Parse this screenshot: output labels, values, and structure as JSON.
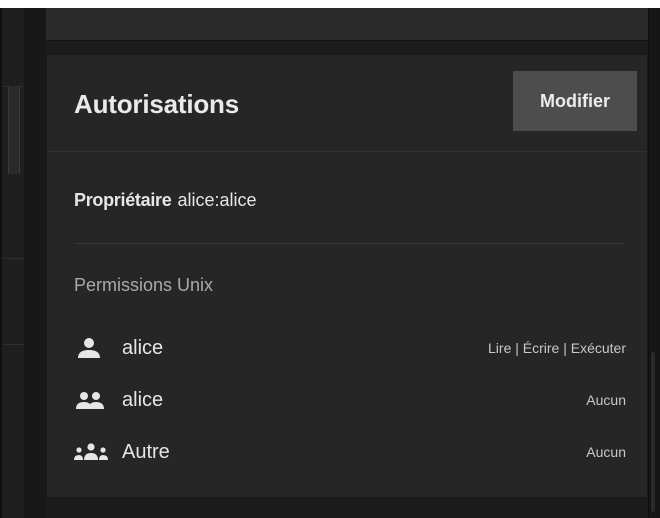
{
  "card": {
    "title": "Autorisations",
    "modify_label": "Modifier"
  },
  "owner": {
    "label": "Propriétaire",
    "value": "alice:alice"
  },
  "unix": {
    "section_label": "Permissions Unix",
    "rows": [
      {
        "icon": "user-icon",
        "name": "alice",
        "value": "Lire | Écrire | Exécuter"
      },
      {
        "icon": "group-icon",
        "name": "alice",
        "value": "Aucun"
      },
      {
        "icon": "others-icon",
        "name": "Autre",
        "value": "Aucun"
      }
    ]
  },
  "colors": {
    "background": "#1c1c1c",
    "card": "#262626",
    "button": "#4d4d4d",
    "text": "#e6e6e6",
    "muted": "#a9a9a9"
  }
}
